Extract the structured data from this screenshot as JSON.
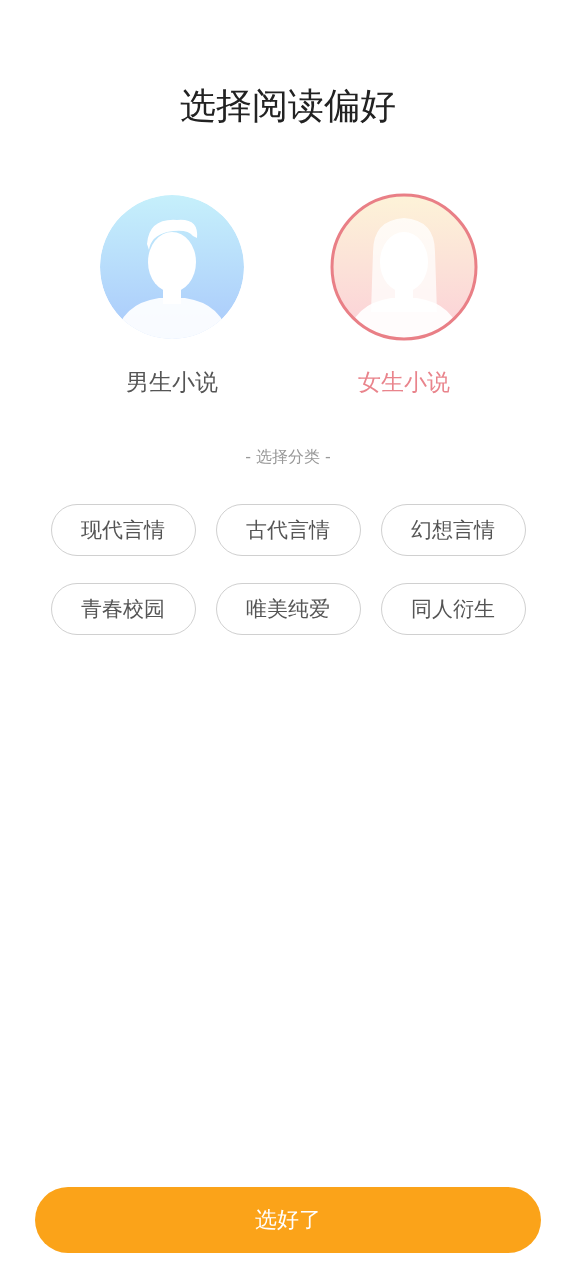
{
  "title": "选择阅读偏好",
  "genders": [
    {
      "label": "男生小说",
      "kind": "male",
      "selected": false
    },
    {
      "label": "女生小说",
      "kind": "female",
      "selected": true
    }
  ],
  "category_heading": "- 选择分类 -",
  "categories": [
    {
      "label": "现代言情",
      "selected": false
    },
    {
      "label": "古代言情",
      "selected": false
    },
    {
      "label": "幻想言情",
      "selected": false
    },
    {
      "label": "青春校园",
      "selected": false
    },
    {
      "label": "唯美纯爱",
      "selected": false
    },
    {
      "label": "同人衍生",
      "selected": false
    }
  ],
  "confirm_button": "选好了"
}
